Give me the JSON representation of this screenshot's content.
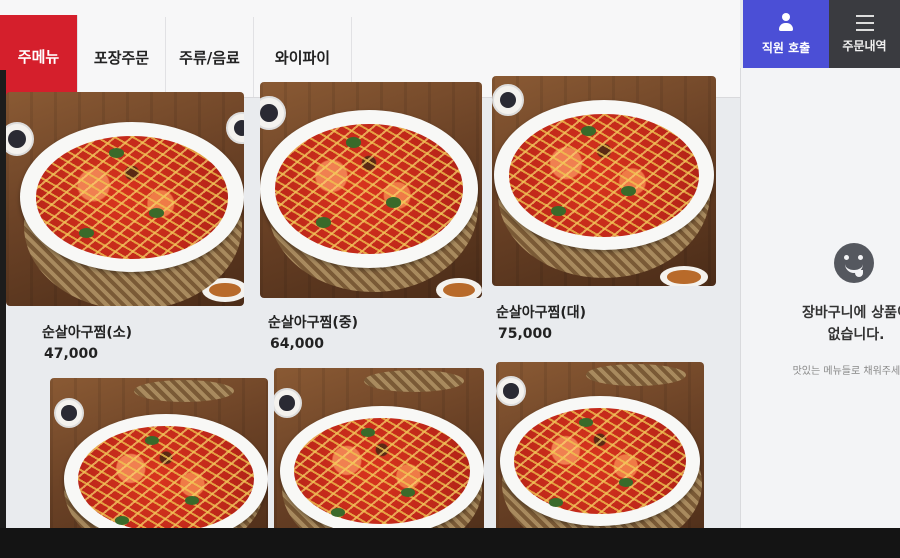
{
  "tabs": [
    {
      "label": "주메뉴",
      "active": true
    },
    {
      "label": "포장주문",
      "active": false
    },
    {
      "label": "주류/음료",
      "active": false
    },
    {
      "label": "와이파이",
      "active": false
    }
  ],
  "header": {
    "call_staff_label": "직원 호출",
    "order_history_label": "주문내역"
  },
  "cart": {
    "icon": "tongue-face-icon",
    "empty_title": "장바구니에 상품이\n없습니다.",
    "empty_subtitle": "맛있는 메뉴들로 채워주세요"
  },
  "menu": {
    "items": [
      {
        "name": "순살아구찜(소)",
        "price": "47,000"
      },
      {
        "name": "순살아구찜(중)",
        "price": "64,000"
      },
      {
        "name": "순살아구찜(대)",
        "price": "75,000"
      },
      {
        "name": "",
        "price": ""
      },
      {
        "name": "",
        "price": ""
      },
      {
        "name": "",
        "price": ""
      }
    ]
  },
  "colors": {
    "active_tab": "#d51f2c",
    "call_button": "#4b4fd6",
    "orders_button": "#3a3b40"
  }
}
